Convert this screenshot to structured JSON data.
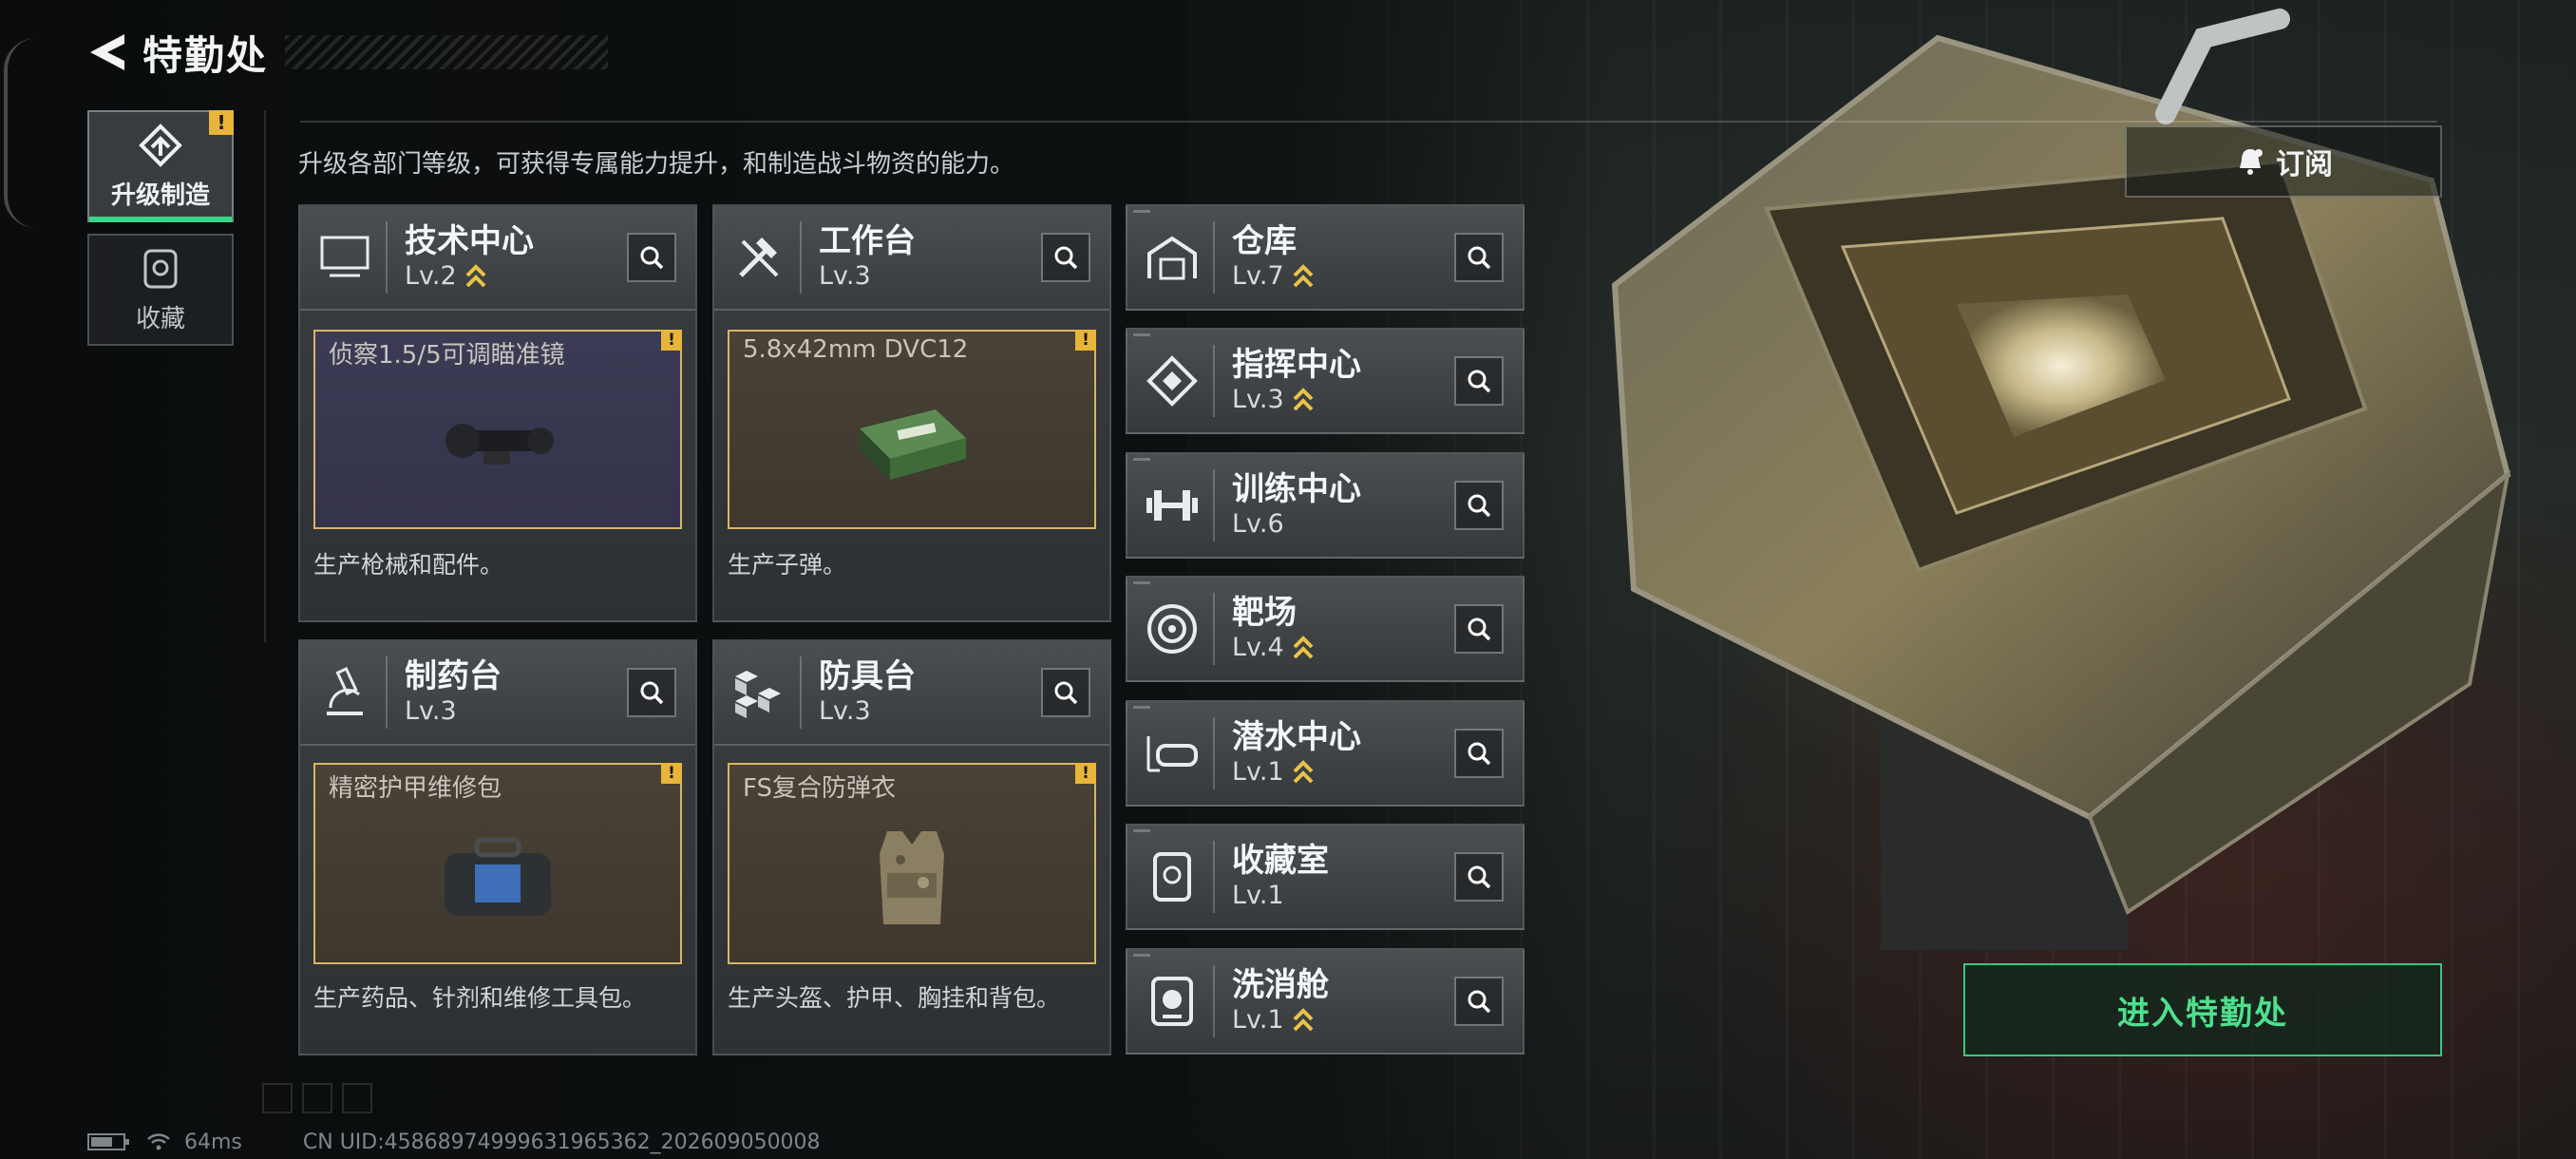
{
  "header": {
    "title": "特勤处"
  },
  "side_tabs": [
    {
      "label": "升级制造",
      "icon": "upgrade-icon",
      "active": true,
      "alert": "!"
    },
    {
      "label": "收藏",
      "icon": "collection-icon",
      "active": false
    }
  ],
  "description": "升级各部门等级，可获得专属能力提升，和制造战斗物资的能力。",
  "grid_cards": [
    {
      "name": "技术中心",
      "level": "Lv.2",
      "upgradable": true,
      "icon": "monitor-icon",
      "craft_item": "侦察1.5/5可调瞄准镜",
      "craft_bg": "purple",
      "alert": "!",
      "item_icon": "scope-icon",
      "desc": "生产枪械和配件。"
    },
    {
      "name": "工作台",
      "level": "Lv.3",
      "upgradable": false,
      "icon": "tools-icon",
      "craft_item": "5.8x42mm DVC12",
      "craft_bg": "brown",
      "alert": "!",
      "item_icon": "ammo-box-icon",
      "desc": "生产子弹。"
    },
    {
      "name": "制药台",
      "level": "Lv.3",
      "upgradable": false,
      "icon": "microscope-icon",
      "craft_item": "精密护甲维修包",
      "craft_bg": "brown",
      "alert": "!",
      "item_icon": "repair-kit-icon",
      "desc": "生产药品、针剂和维修工具包。"
    },
    {
      "name": "防具台",
      "level": "Lv.3",
      "upgradable": false,
      "icon": "armor-blocks-icon",
      "craft_item": "FS复合防弹衣",
      "craft_bg": "brown",
      "alert": "!",
      "item_icon": "vest-icon",
      "desc": "生产头盔、护甲、胸挂和背包。"
    }
  ],
  "list_cards": [
    {
      "name": "仓库",
      "level": "Lv.7",
      "upgradable": true,
      "icon": "warehouse-icon"
    },
    {
      "name": "指挥中心",
      "level": "Lv.3",
      "upgradable": true,
      "icon": "command-icon"
    },
    {
      "name": "训练中心",
      "level": "Lv.6",
      "upgradable": false,
      "icon": "dumbbell-icon"
    },
    {
      "name": "靶场",
      "level": "Lv.4",
      "upgradable": true,
      "icon": "target-icon"
    },
    {
      "name": "潜水中心",
      "level": "Lv.1",
      "upgradable": true,
      "icon": "diving-mask-icon"
    },
    {
      "name": "收藏室",
      "level": "Lv.1",
      "upgradable": false,
      "icon": "collection-room-icon"
    },
    {
      "name": "洗消舱",
      "level": "Lv.1",
      "upgradable": true,
      "icon": "decon-pod-icon"
    }
  ],
  "subscribe": {
    "label": "订阅",
    "icon": "subscribe-bell-icon"
  },
  "enter_button": {
    "label": "进入特勤处"
  },
  "footer": {
    "ping": "64ms",
    "uid": "CN UID:4586897499963196536​2_202609050008",
    "battery_level": 0.7
  },
  "colors": {
    "accent_green": "#39d68a",
    "alert_yellow": "#e8b43a",
    "upgrade_gold": "#e8c24a",
    "craft_border": "#d7b562"
  }
}
